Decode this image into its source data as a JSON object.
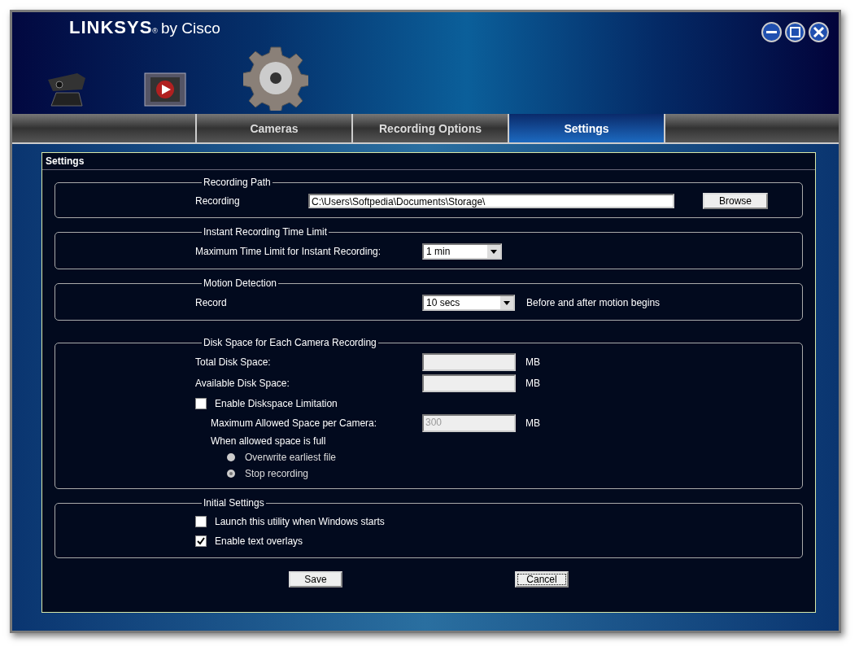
{
  "window": {
    "brand": "LINKSYS",
    "brand_mark": "®",
    "brand_suffix": "by Cisco"
  },
  "tabs": [
    {
      "label": "Cameras",
      "selected": false
    },
    {
      "label": "Recording Options",
      "selected": false
    },
    {
      "label": "Settings",
      "selected": true
    }
  ],
  "panel": {
    "title": "Settings"
  },
  "sections": [
    {
      "title": "Recording Path",
      "rows": [
        {
          "kind": "path",
          "label": "Recording",
          "value": "C:\\Users\\Softpedia\\Documents\\Storage\\",
          "button": "Browse"
        }
      ]
    },
    {
      "title": "Instant Recording Time Limit",
      "rows": [
        {
          "kind": "select",
          "label": "Maximum Time Limit for Instant Recording:",
          "value": "1 min"
        }
      ]
    },
    {
      "title": "Motion Detection",
      "rows": [
        {
          "kind": "select",
          "label": "Record",
          "value": "10 secs",
          "note": "Before and after motion begins"
        }
      ]
    },
    {
      "title": "Disk Space for Each Camera Recording",
      "rows": [
        {
          "kind": "readonly",
          "label": "Total Disk Space:",
          "unit": "MB"
        },
        {
          "kind": "readonly",
          "label": "Available Disk Space:",
          "unit": "MB"
        },
        {
          "kind": "checkbox",
          "label": "Enable Diskspace Limitation",
          "checked": false
        },
        {
          "kind": "field",
          "label": "Maximum Allowed Space per Camera:",
          "value": "300",
          "unit": "MB",
          "disabled": true
        },
        {
          "kind": "text",
          "label": "When allowed space is full"
        },
        {
          "kind": "radio",
          "label": "Overwrite earliest file",
          "selected": false,
          "disabled": true
        },
        {
          "kind": "radio",
          "label": "Stop recording",
          "selected": true,
          "disabled": true
        }
      ]
    },
    {
      "title": "Initial Settings",
      "rows": [
        {
          "kind": "checkbox",
          "label": "Launch this utility when Windows starts",
          "checked": false
        },
        {
          "kind": "checkbox",
          "label": "Enable text overlays",
          "checked": true
        }
      ]
    }
  ],
  "buttons": [
    {
      "label": "Save",
      "focused": false
    },
    {
      "label": "Cancel",
      "focused": true
    }
  ]
}
